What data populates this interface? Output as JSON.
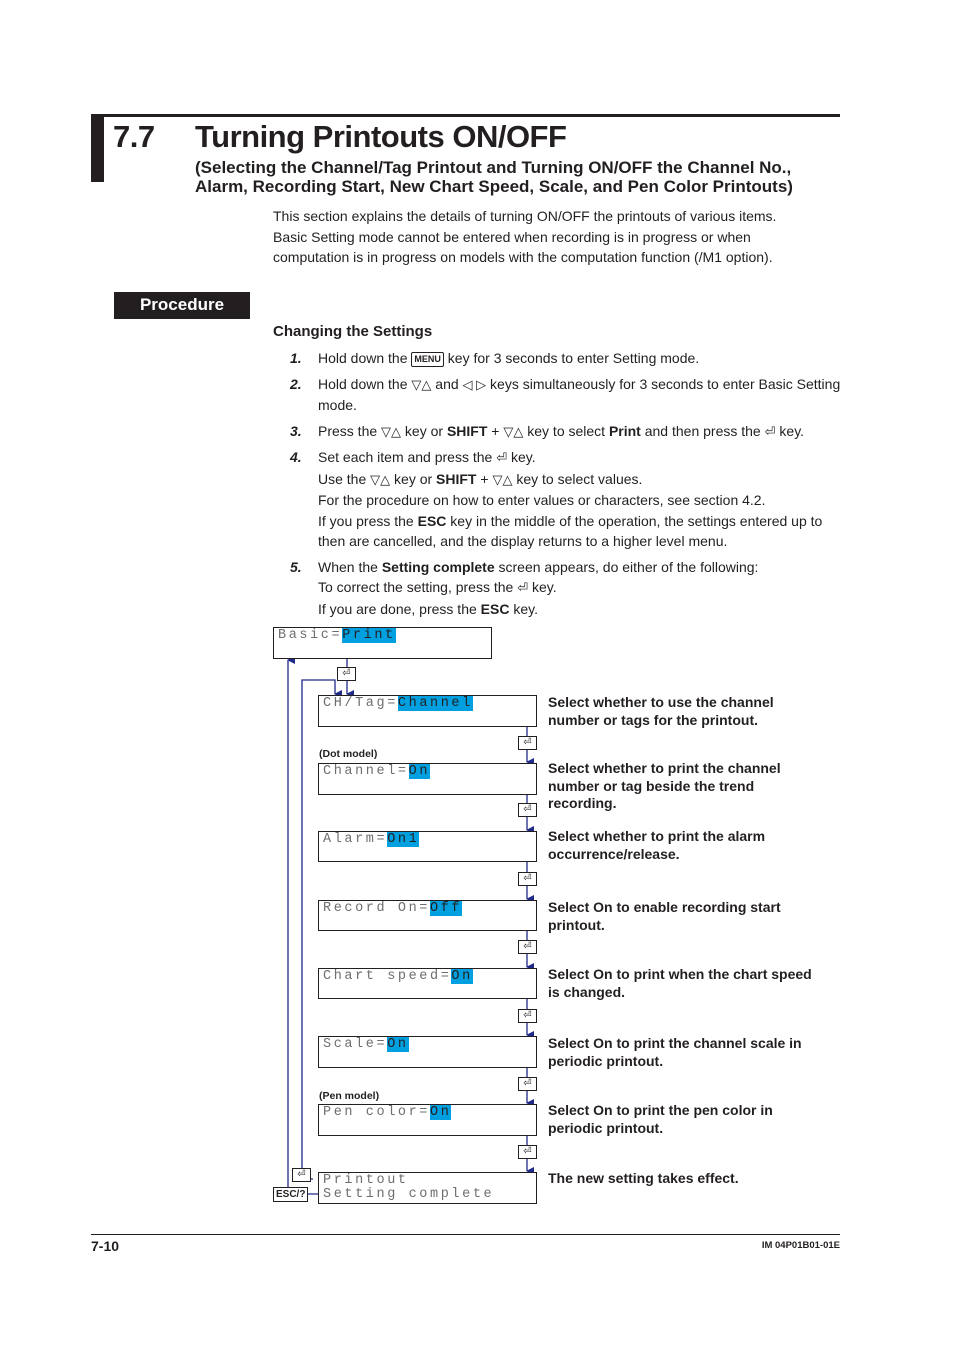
{
  "section": {
    "number": "7.7",
    "title": "Turning Printouts ON/OFF",
    "subtitle_line1": "(Selecting the Channel/Tag Printout and Turning ON/OFF the Channel No.,",
    "subtitle_line2": "Alarm, Recording Start, New Chart Speed, Scale, and Pen Color Printouts)"
  },
  "intro": {
    "line1": "This section explains the details of turning ON/OFF the printouts of various items.",
    "line2": "Basic Setting mode cannot be entered when recording is in progress or when",
    "line3": "computation is in progress on models with the computation function (/M1 option)."
  },
  "procedure_badge": "Procedure",
  "subheading": "Changing the Settings",
  "keys": {
    "menu": "MENU",
    "updown": "▽△",
    "leftright": "◁ ▷",
    "enter": "⏎",
    "shift": "SHIFT",
    "esc": "ESC",
    "esc_help": "ESC/?"
  },
  "steps": [
    {
      "num": "1.",
      "a": "Hold down the ",
      "b": " key for 3 seconds to enter Setting mode."
    },
    {
      "num": "2.",
      "a": "Hold down the ",
      "b": " and ",
      "c": " keys simultaneously for 3 seconds to enter Basic Setting mode."
    },
    {
      "num": "3.",
      "a": "Press the ",
      "b": " key or ",
      "c": " + ",
      "d": " key to select ",
      "e": "Print",
      "f": " and then press the ",
      "g": " key."
    },
    {
      "num": "4.",
      "a": "Set each item and press the ",
      "b": " key.",
      "c": "Use the ",
      "d": " key or ",
      "e": " + ",
      "f": " key to select values.",
      "g": "For the procedure on how to enter values or characters, see section 4.2.",
      "h": "If you press the ",
      "i": " key in the middle of the operation, the settings entered up to then are cancelled, and the display returns to a higher level menu."
    },
    {
      "num": "5.",
      "a": "When the ",
      "b": "Setting complete",
      "c": " screen appears, do either of the following:",
      "d": "To correct the setting, press the ",
      "e": " key.",
      "f": "If you are done, press the ",
      "g": " key."
    }
  ],
  "flow": {
    "basic": {
      "label": "Basic=",
      "value": "Print"
    },
    "screens": [
      {
        "label": "CH/Tag=",
        "value": "Channel",
        "note": "",
        "desc": "Select whether to use the channel number or tags for the printout."
      },
      {
        "label": "Channel=",
        "value": "On",
        "note": "(Dot model)",
        "desc": "Select whether to print the channel number or tag beside the trend recording."
      },
      {
        "label": "Alarm=",
        "value": "On1",
        "note": "",
        "desc": "Select whether to print the alarm occurrence/release."
      },
      {
        "label": "Record On=",
        "value": "Off",
        "note": "",
        "desc": "Select On to enable recording start printout."
      },
      {
        "label": "Chart speed=",
        "value": "On",
        "note": "",
        "desc": "Select On to print when the chart speed is changed."
      },
      {
        "label": "Scale=",
        "value": "On",
        "note": "",
        "desc": "Select On to print the channel scale in periodic printout."
      },
      {
        "label": "Pen color=",
        "value": "On",
        "note": "(Pen model)",
        "desc": "Select On to print the pen color in periodic printout."
      }
    ],
    "complete": {
      "line1": "Printout",
      "line2": "Setting complete",
      "desc": "The new setting takes effect."
    }
  },
  "footer": {
    "page": "7-10",
    "doc_id": "IM 04P01B01-01E"
  },
  "colors": {
    "highlight": "#00a0e0",
    "flow_line": "#1f2a8a",
    "text": "#231f20"
  }
}
